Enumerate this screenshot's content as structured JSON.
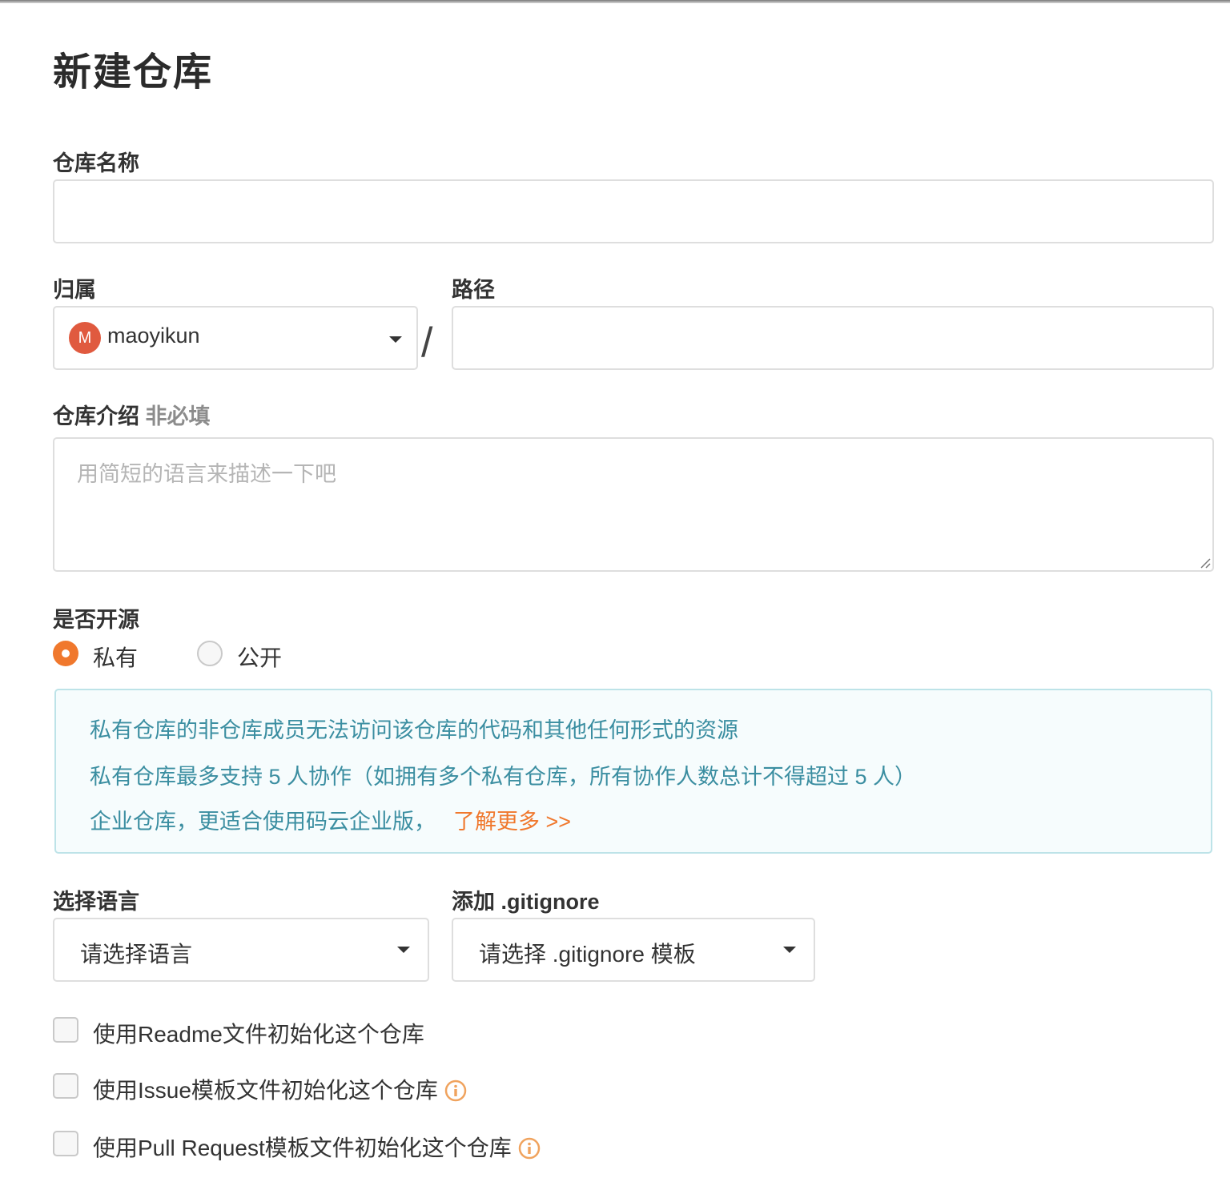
{
  "page": {
    "title": "新建仓库"
  },
  "form": {
    "repo_name": {
      "label": "仓库名称",
      "value": ""
    },
    "owner": {
      "label": "归属",
      "avatar_initial": "M",
      "avatar_color": "#e05a3f",
      "selected": "maoyikun"
    },
    "path": {
      "label": "路径",
      "separator": "/",
      "value": ""
    },
    "description": {
      "label": "仓库介绍",
      "optional_tag": "非必填",
      "placeholder": "用简短的语言来描述一下吧"
    },
    "visibility": {
      "label": "是否开源",
      "options": [
        {
          "label": "私有",
          "selected": true
        },
        {
          "label": "公开",
          "selected": false
        }
      ]
    },
    "notice": {
      "lines": [
        "私有仓库的非仓库成员无法访问该仓库的代码和其他任何形式的资源",
        "私有仓库最多支持 5 人协作（如拥有多个私有仓库，所有协作人数总计不得超过 5 人）",
        "企业仓库，更适合使用码云企业版，"
      ],
      "link_text": "了解更多 >>"
    },
    "language": {
      "label": "选择语言",
      "selected": "请选择语言"
    },
    "gitignore": {
      "label": "添加 .gitignore",
      "selected": "请选择 .gitignore 模板"
    },
    "checkboxes": [
      {
        "label": "使用Readme文件初始化这个仓库",
        "checked": false,
        "info_icon": false
      },
      {
        "label": "使用Issue模板文件初始化这个仓库",
        "checked": false,
        "info_icon": true
      },
      {
        "label": "使用Pull Request模板文件初始化这个仓库",
        "checked": false,
        "info_icon": true
      }
    ]
  },
  "colors": {
    "accent": "#f0782d",
    "notice_text": "#3b8ea1",
    "notice_bg": "#f6fcfd",
    "notice_border": "#bde3e8"
  }
}
